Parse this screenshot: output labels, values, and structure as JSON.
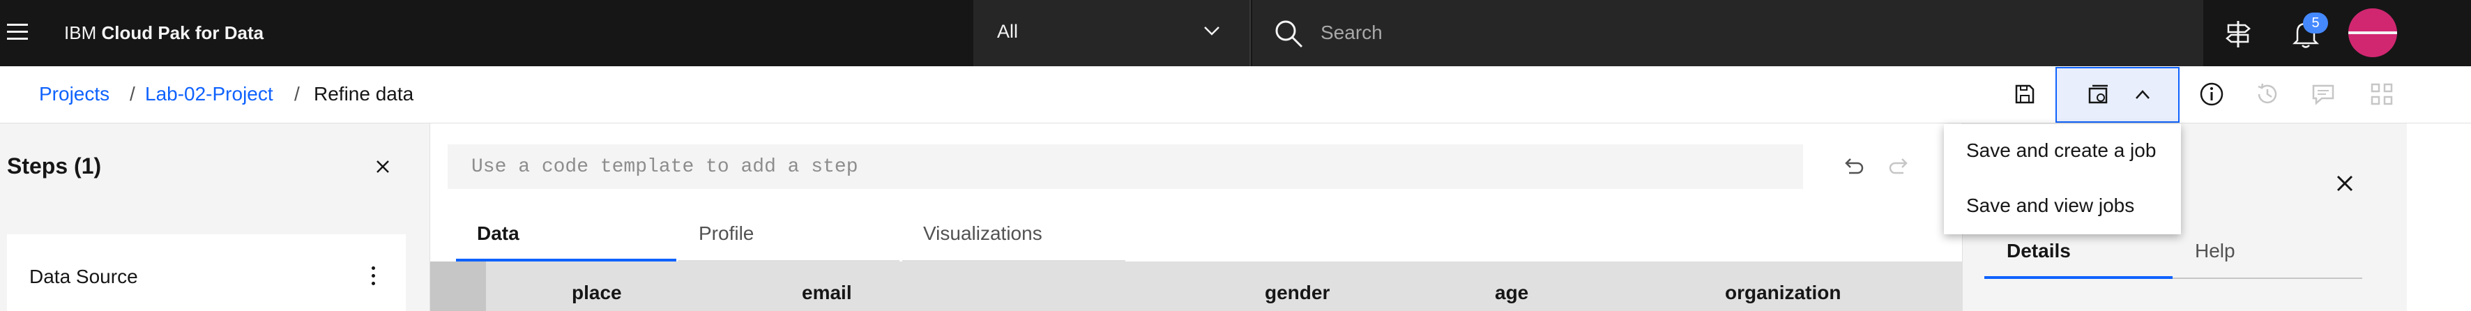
{
  "header": {
    "brand_prefix": "IBM",
    "brand_product": "Cloud Pak for Data",
    "scope_value": "All",
    "search_placeholder": "Search",
    "notification_count": "5"
  },
  "breadcrumb": {
    "items": [
      {
        "label": "Projects"
      },
      {
        "label": "Lab-02-Project"
      },
      {
        "label": "Refine data"
      }
    ],
    "separator": "/"
  },
  "save_menu": {
    "items": [
      {
        "label": "Save and create a job"
      },
      {
        "label": "Save and view jobs"
      }
    ]
  },
  "steps_panel": {
    "title": "Steps (1)",
    "steps": [
      {
        "label": "Data Source"
      }
    ]
  },
  "main": {
    "code_placeholder": "Use a code template to add a step",
    "tabs": [
      {
        "label": "Data",
        "active": true
      },
      {
        "label": "Profile",
        "active": false
      },
      {
        "label": "Visualizations",
        "active": false
      }
    ],
    "table": {
      "columns": [
        "place",
        "email",
        "gender",
        "age",
        "organization"
      ]
    }
  },
  "side_panel": {
    "tabs": [
      {
        "label": "Details",
        "active": true
      },
      {
        "label": "Help",
        "active": false
      }
    ]
  },
  "colors": {
    "topbar_bg": "#161616",
    "link": "#0f62fe",
    "panel_bg": "#f4f4f4",
    "avatar": "#d12771",
    "badge": "#4589ff"
  }
}
